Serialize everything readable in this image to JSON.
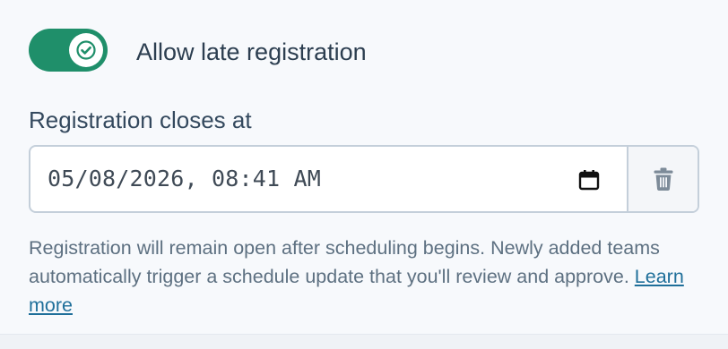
{
  "late_registration": {
    "toggle_on": true,
    "label": "Allow late registration",
    "accent_color": "#1f8f6a",
    "toggle_icon": "check-icon"
  },
  "closes_at": {
    "label": "Registration closes at",
    "value": "05/08/2026, 08:41 AM",
    "picker_icon": "calendar-icon",
    "clear_icon": "trash-icon"
  },
  "help": {
    "text": "Registration will remain open after scheduling begins. Newly added teams automatically trigger a schedule update that you'll review and approve.",
    "link_text": "Learn more"
  }
}
